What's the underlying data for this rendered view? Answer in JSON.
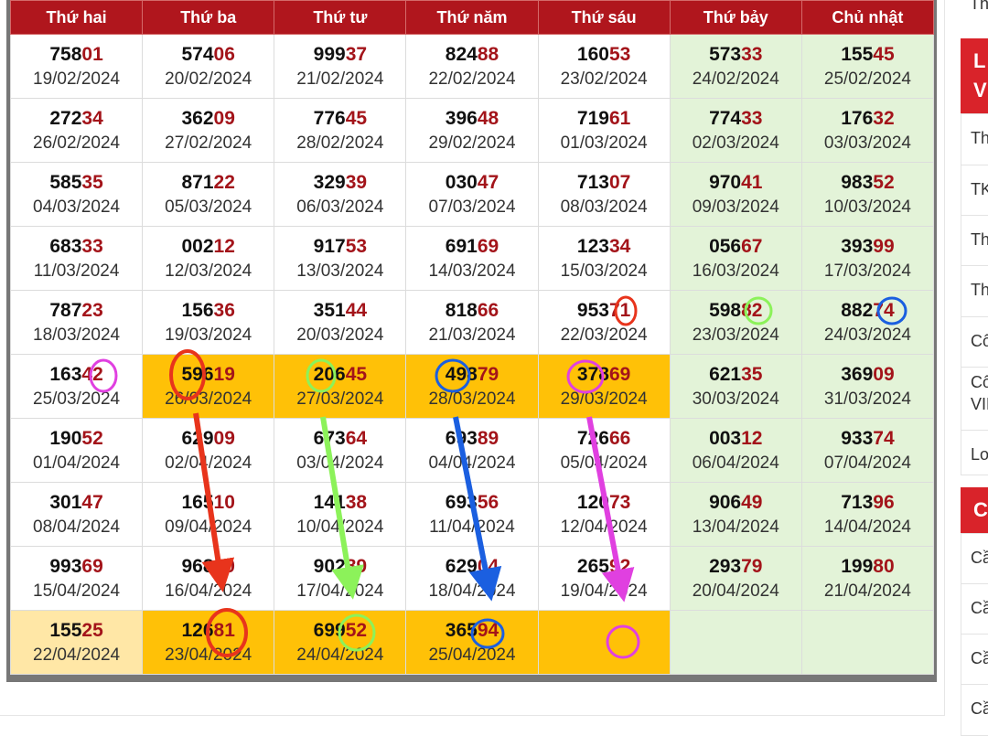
{
  "table": {
    "headers": [
      "Thứ hai",
      "Thứ ba",
      "Thứ tư",
      "Thứ năm",
      "Thứ sáu",
      "Thứ bảy",
      "Chủ nhật"
    ],
    "rows": [
      [
        {
          "h": "758",
          "t": "01",
          "d": "19/02/2024"
        },
        {
          "h": "574",
          "t": "06",
          "d": "20/02/2024"
        },
        {
          "h": "999",
          "t": "37",
          "d": "21/02/2024"
        },
        {
          "h": "824",
          "t": "88",
          "d": "22/02/2024"
        },
        {
          "h": "160",
          "t": "53",
          "d": "23/02/2024"
        },
        {
          "h": "573",
          "t": "33",
          "d": "24/02/2024"
        },
        {
          "h": "155",
          "t": "45",
          "d": "25/02/2024"
        }
      ],
      [
        {
          "h": "272",
          "t": "34",
          "d": "26/02/2024"
        },
        {
          "h": "362",
          "t": "09",
          "d": "27/02/2024"
        },
        {
          "h": "776",
          "t": "45",
          "d": "28/02/2024"
        },
        {
          "h": "396",
          "t": "48",
          "d": "29/02/2024"
        },
        {
          "h": "719",
          "t": "61",
          "d": "01/03/2024"
        },
        {
          "h": "774",
          "t": "33",
          "d": "02/03/2024"
        },
        {
          "h": "176",
          "t": "32",
          "d": "03/03/2024"
        }
      ],
      [
        {
          "h": "585",
          "t": "35",
          "d": "04/03/2024"
        },
        {
          "h": "871",
          "t": "22",
          "d": "05/03/2024"
        },
        {
          "h": "329",
          "t": "39",
          "d": "06/03/2024"
        },
        {
          "h": "030",
          "t": "47",
          "d": "07/03/2024"
        },
        {
          "h": "713",
          "t": "07",
          "d": "08/03/2024"
        },
        {
          "h": "970",
          "t": "41",
          "d": "09/03/2024"
        },
        {
          "h": "983",
          "t": "52",
          "d": "10/03/2024"
        }
      ],
      [
        {
          "h": "683",
          "t": "33",
          "d": "11/03/2024"
        },
        {
          "h": "002",
          "t": "12",
          "d": "12/03/2024"
        },
        {
          "h": "917",
          "t": "53",
          "d": "13/03/2024"
        },
        {
          "h": "691",
          "t": "69",
          "d": "14/03/2024"
        },
        {
          "h": "123",
          "t": "34",
          "d": "15/03/2024"
        },
        {
          "h": "056",
          "t": "67",
          "d": "16/03/2024"
        },
        {
          "h": "393",
          "t": "99",
          "d": "17/03/2024"
        }
      ],
      [
        {
          "h": "787",
          "t": "23",
          "d": "18/03/2024"
        },
        {
          "h": "156",
          "t": "36",
          "d": "19/03/2024"
        },
        {
          "h": "351",
          "t": "44",
          "d": "20/03/2024"
        },
        {
          "h": "818",
          "t": "66",
          "d": "21/03/2024"
        },
        {
          "h": "953",
          "t": "71",
          "d": "22/03/2024"
        },
        {
          "h": "598",
          "t": "82",
          "d": "23/03/2024"
        },
        {
          "h": "882",
          "t": "74",
          "d": "24/03/2024"
        }
      ],
      [
        {
          "h": "163",
          "t": "42",
          "d": "25/03/2024"
        },
        {
          "h": "596",
          "t": "19",
          "d": "26/03/2024"
        },
        {
          "h": "206",
          "t": "45",
          "d": "27/03/2024"
        },
        {
          "h": "498",
          "t": "79",
          "d": "28/03/2024"
        },
        {
          "h": "378",
          "t": "69",
          "d": "29/03/2024"
        },
        {
          "h": "621",
          "t": "35",
          "d": "30/03/2024"
        },
        {
          "h": "369",
          "t": "09",
          "d": "31/03/2024"
        }
      ],
      [
        {
          "h": "190",
          "t": "52",
          "d": "01/04/2024"
        },
        {
          "h": "629",
          "t": "09",
          "d": "02/04/2024"
        },
        {
          "h": "673",
          "t": "64",
          "d": "03/04/2024"
        },
        {
          "h": "693",
          "t": "89",
          "d": "04/04/2024"
        },
        {
          "h": "726",
          "t": "66",
          "d": "05/04/2024"
        },
        {
          "h": "003",
          "t": "12",
          "d": "06/04/2024"
        },
        {
          "h": "933",
          "t": "74",
          "d": "07/04/2024"
        }
      ],
      [
        {
          "h": "301",
          "t": "47",
          "d": "08/04/2024"
        },
        {
          "h": "165",
          "t": "10",
          "d": "09/04/2024"
        },
        {
          "h": "141",
          "t": "38",
          "d": "10/04/2024"
        },
        {
          "h": "693",
          "t": "56",
          "d": "11/04/2024"
        },
        {
          "h": "120",
          "t": "73",
          "d": "12/04/2024"
        },
        {
          "h": "906",
          "t": "49",
          "d": "13/04/2024"
        },
        {
          "h": "713",
          "t": "96",
          "d": "14/04/2024"
        }
      ],
      [
        {
          "h": "993",
          "t": "69",
          "d": "15/04/2024"
        },
        {
          "h": "968",
          "t": "80",
          "d": "16/04/2024"
        },
        {
          "h": "902",
          "t": "89",
          "d": "17/04/2024"
        },
        {
          "h": "629",
          "t": "04",
          "d": "18/04/2024"
        },
        {
          "h": "265",
          "t": "92",
          "d": "19/04/2024"
        },
        {
          "h": "293",
          "t": "79",
          "d": "20/04/2024"
        },
        {
          "h": "199",
          "t": "80",
          "d": "21/04/2024"
        }
      ],
      [
        {
          "h": "155",
          "t": "25",
          "d": "22/04/2024"
        },
        {
          "h": "126",
          "t": "81",
          "d": "23/04/2024"
        },
        {
          "h": "699",
          "t": "52",
          "d": "24/04/2024"
        },
        {
          "h": "365",
          "t": "94",
          "d": "25/04/2024"
        },
        {
          "h": "",
          "t": "",
          "d": ""
        },
        {
          "h": "",
          "t": "",
          "d": ""
        },
        {
          "h": "",
          "t": "",
          "d": ""
        }
      ]
    ],
    "highlight_color": "#ffc107",
    "weekend_color": "#e3f3d8",
    "today_color": "#ffe7a6",
    "header_color": "#b0161d"
  },
  "annotations": {
    "colors": {
      "red": "#e8341c",
      "green": "#8cf25a",
      "blue": "#1b5fe0",
      "magenta": "#e040e0"
    }
  },
  "sidebar": {
    "top_text": "Th",
    "header1": [
      "L",
      "V"
    ],
    "items1": [
      "Th",
      "TK",
      "Th",
      "Th",
      "Cô",
      "Cô",
      "VIP",
      "Lo"
    ],
    "header2": "C",
    "items2": [
      "Cầ",
      "Cầ",
      "Cầ",
      "Cầ"
    ]
  }
}
